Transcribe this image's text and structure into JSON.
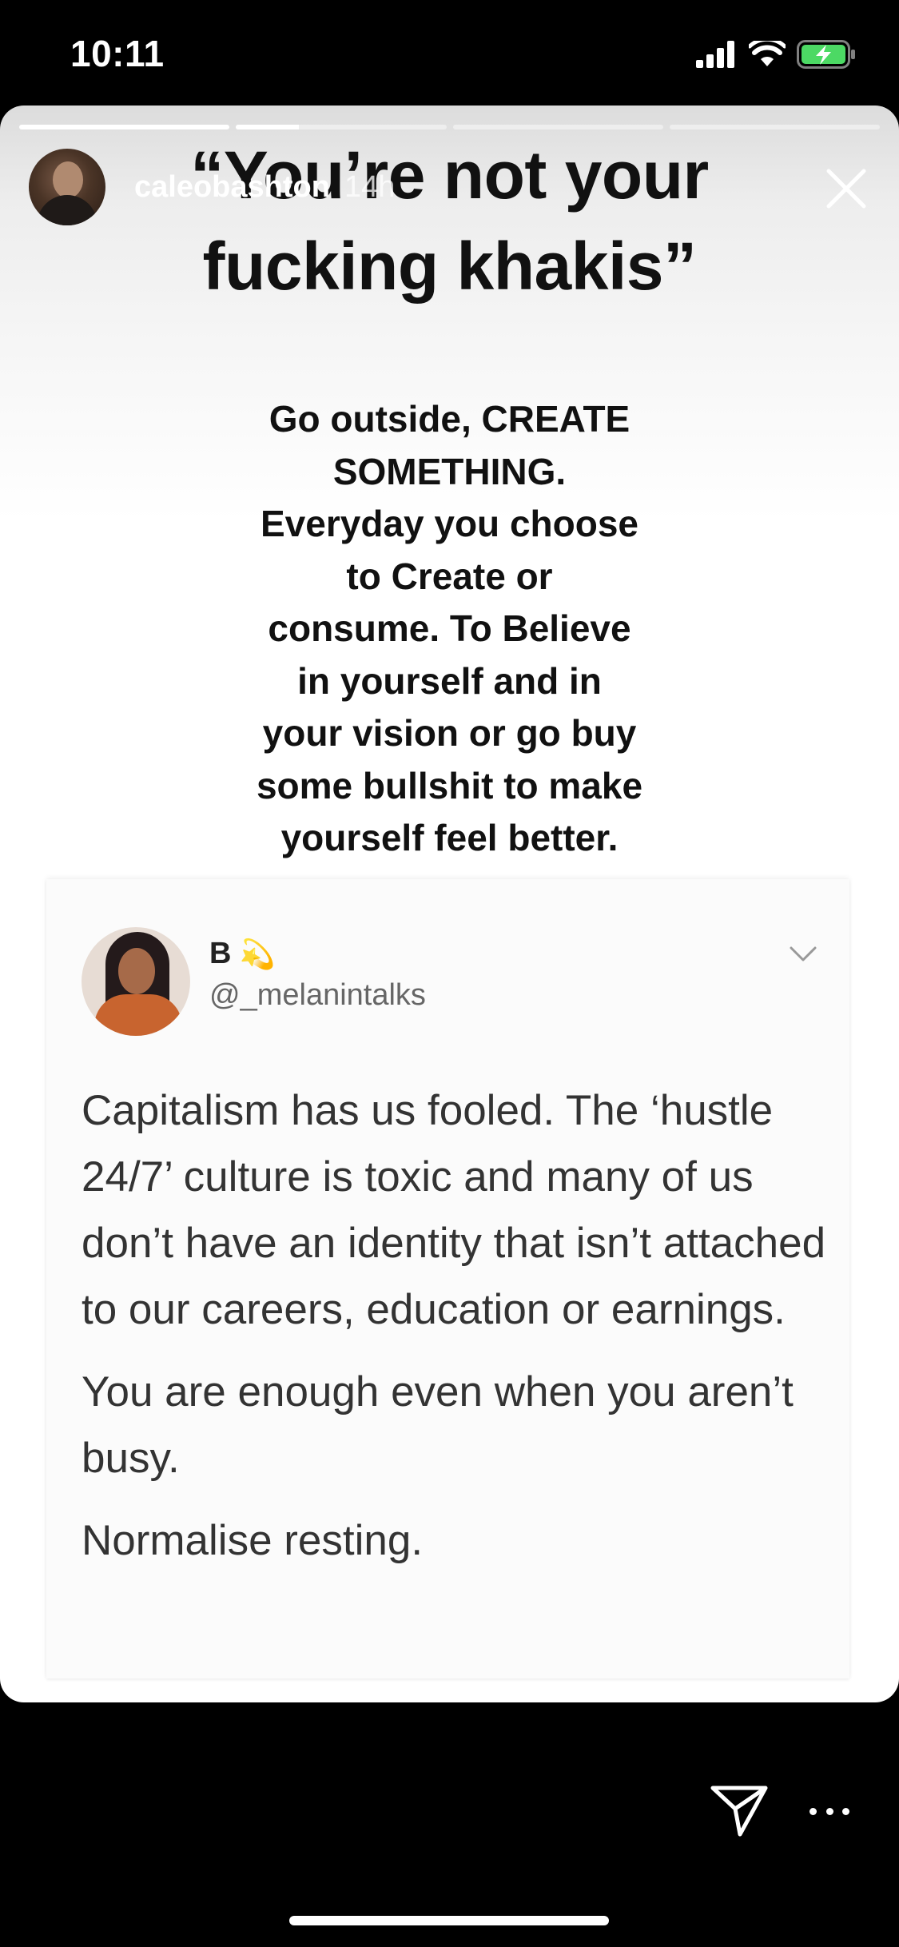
{
  "status_bar": {
    "time": "10:11",
    "icons": [
      "signal-icon",
      "wifi-icon",
      "battery-charging-icon"
    ]
  },
  "story": {
    "progress_segments": [
      1,
      0.3,
      0,
      0
    ],
    "username": "caleobashton",
    "time_ago": "14h",
    "headline_line1": "“You’re not your",
    "headline_line2": "fucking khakis”",
    "message_lines": [
      "Go outside, CREATE",
      "SOMETHING.",
      "Everyday you choose",
      "to Create or",
      "consume.  To Believe",
      "in yourself and in",
      "your vision or go buy",
      "some bullshit to make",
      "yourself feel better."
    ]
  },
  "tweet": {
    "name": "B",
    "name_emoji": "💫",
    "handle": "@_melanintalks",
    "paragraphs": [
      "Capitalism has us fooled. The ‘hustle 24/7’ culture is toxic and many of us don’t have an identity that isn’t attached to our careers, education or earnings.",
      "You are enough even when you aren’t busy.",
      "Normalise resting."
    ]
  },
  "colors": {
    "background": "#000000",
    "card_text": "#111111",
    "tweet_text": "#333333",
    "tweet_handle": "#666666",
    "battery_charging": "#4cd964"
  }
}
